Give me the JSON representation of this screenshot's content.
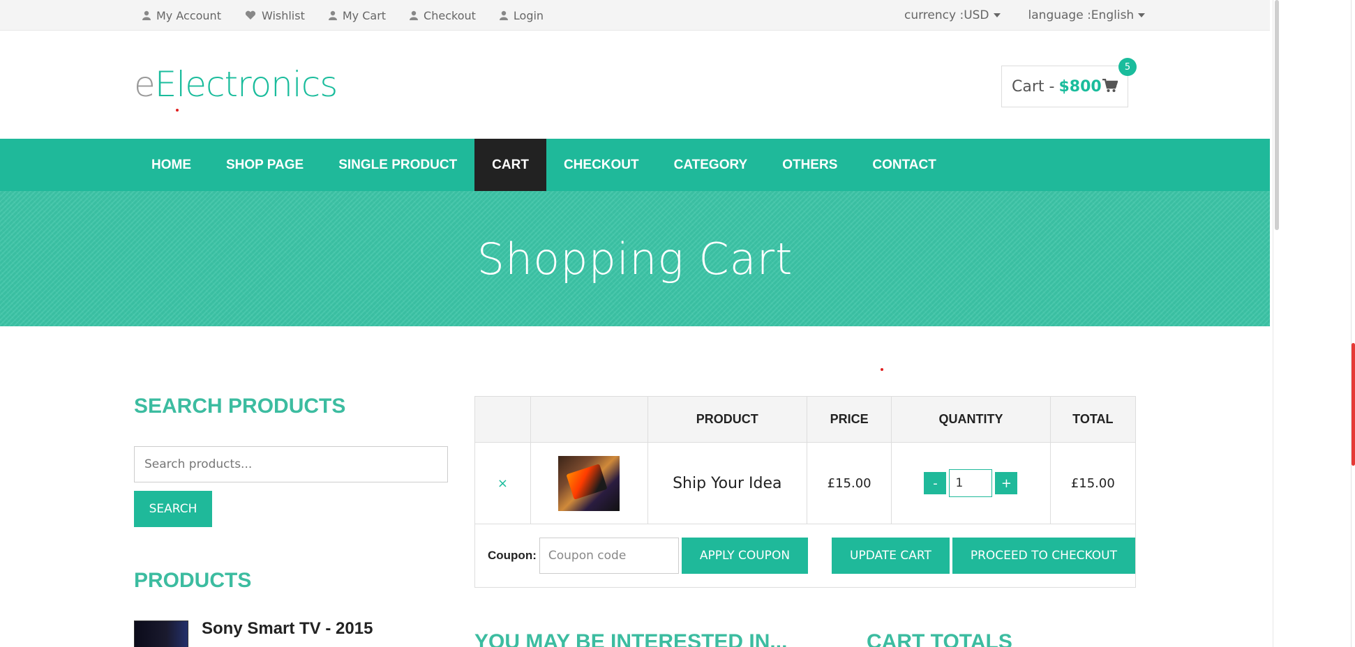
{
  "topbar": {
    "links": [
      {
        "icon": "user-icon",
        "label": "My Account"
      },
      {
        "icon": "heart-icon",
        "label": "Wishlist"
      },
      {
        "icon": "user-icon",
        "label": "My Cart"
      },
      {
        "icon": "user-icon",
        "label": "Checkout"
      },
      {
        "icon": "user-icon",
        "label": "Login"
      }
    ],
    "currency_label": "currency :USD",
    "language_label": "language :English"
  },
  "header": {
    "logo_prefix": "e",
    "logo_main": "Electronics",
    "cart_label": "Cart -",
    "cart_amount": "$800",
    "cart_count": "5"
  },
  "nav": {
    "items": [
      {
        "label": "HOME",
        "active": false
      },
      {
        "label": "SHOP PAGE",
        "active": false
      },
      {
        "label": "SINGLE PRODUCT",
        "active": false
      },
      {
        "label": "CART",
        "active": true
      },
      {
        "label": "CHECKOUT",
        "active": false
      },
      {
        "label": "CATEGORY",
        "active": false
      },
      {
        "label": "OTHERS",
        "active": false
      },
      {
        "label": "CONTACT",
        "active": false
      }
    ]
  },
  "banner": {
    "title": "Shopping Cart"
  },
  "sidebar": {
    "search_title": "SEARCH PRODUCTS",
    "search_placeholder": "Search products...",
    "search_button": "SEARCH",
    "products_title": "PRODUCTS",
    "product_name": "Sony Smart TV - 2015"
  },
  "cart": {
    "headers": [
      "",
      "",
      "PRODUCT",
      "PRICE",
      "QUANTITY",
      "TOTAL"
    ],
    "item": {
      "remove": "×",
      "name": "Ship Your Idea",
      "price": "£15.00",
      "quantity": "1",
      "total": "£15.00"
    },
    "qty_minus": "-",
    "qty_plus": "+",
    "coupon_label": "Coupon:",
    "coupon_placeholder": "Coupon code",
    "apply_coupon": "APPLY COUPON",
    "update_cart": "UPDATE CART",
    "proceed": "PROCEED TO CHECKOUT"
  },
  "sections": {
    "interested": "YOU MAY BE INTERESTED IN...",
    "totals": "CART TOTALS"
  },
  "colors": {
    "accent": "#1abc9c",
    "nav_active": "#222222"
  }
}
